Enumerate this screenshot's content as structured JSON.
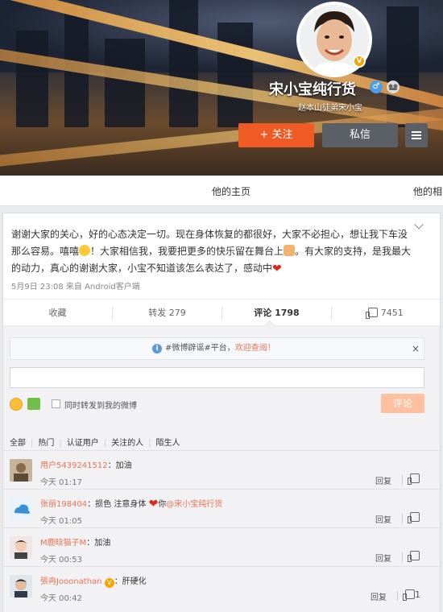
{
  "profile": {
    "name": "宋小宝纯行货",
    "intro": "赵本山徒弟宋小宝",
    "follow_label": "+ 关注",
    "message_label": "私信",
    "gender_glyph": "♂",
    "verified_glyph": "V"
  },
  "tabs": [
    {
      "label": "他的主页"
    },
    {
      "label": "他的相"
    }
  ],
  "post": {
    "text_1": "谢谢大家的关心，好的心态决定一切。现在身体恢复的都很好，大家不必担心，想让我下车没那么容易。嘻嘻",
    "text_2": "！大家相信我，我要把更多的快乐留在舞台上",
    "text_3": "。有大家的支持，是我最大的动力，真心的谢谢大家，小宝不知道该怎么表达了，感动中",
    "heart": "❤",
    "meta": "5月9日 23:08 来自 Android客户端"
  },
  "actions": {
    "favorite": "收藏",
    "repost": "转发 279",
    "comment": "评论 1798",
    "like": "7451"
  },
  "comment_box": {
    "notice": "#微博辟谣#平台，",
    "notice_highlight": "欢迎查阅！",
    "close": "×",
    "info_glyph": "i",
    "repost_label": "同时转发到我的微博",
    "submit_label": "评论"
  },
  "filters": [
    "全部",
    "热门",
    "认证用户",
    "关注的人",
    "陌生人"
  ],
  "comments": [
    {
      "user": "用户5439241512",
      "content": "：加油",
      "time": "今天 01:17",
      "reply": "回复",
      "likes": ""
    },
    {
      "user": "张丽198404",
      "content": "：损色 注意身体",
      "heart": "❤",
      "tail": "你",
      "mention": "@宋小宝纯行货",
      "time": "今天 01:05",
      "reply": "回复",
      "likes": ""
    },
    {
      "user": "M鹿晗猫子M",
      "content": "：加油",
      "time": "今天 00:53",
      "reply": "回复",
      "likes": ""
    },
    {
      "user": "張冉Jooonathan",
      "verified": "V",
      "content": "：肝硬化",
      "time": "今天 00:42",
      "reply": "回复",
      "likes": "1"
    }
  ]
}
